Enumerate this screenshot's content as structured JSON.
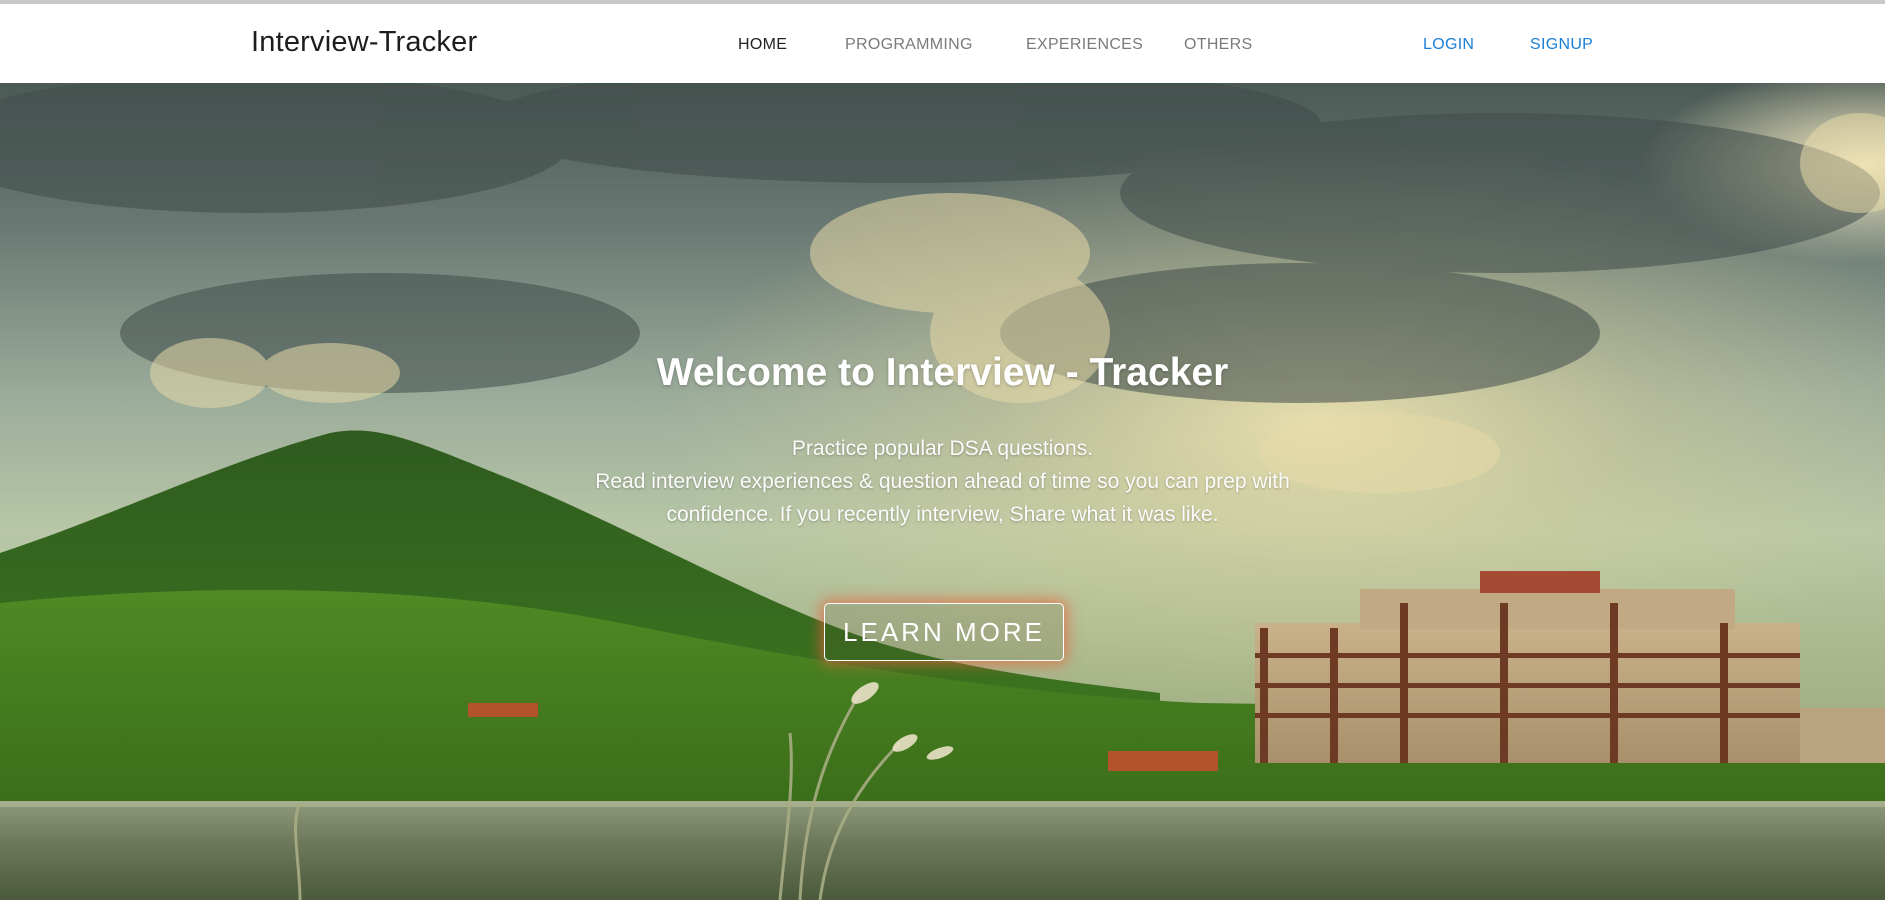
{
  "navbar": {
    "brand": "Interview-Tracker",
    "links": [
      "HOME",
      "PROGRAMMING",
      "EXPERIENCES",
      "OTHERS"
    ],
    "auth": [
      "LOGIN",
      "SIGNUP"
    ],
    "active_link": "HOME"
  },
  "hero": {
    "title": "Welcome to Interview - Tracker",
    "lines": [
      "Practice popular DSA  questions.",
      "Read interview experiences & question  ahead  of time so you can prep with",
      "confidence. If you recently interview, Share what it was like."
    ],
    "button": "LEARN MORE",
    "background_image": "landscape-hill-lake-campus-building"
  },
  "colors": {
    "link_accent": "#1a7fd6",
    "nav_text": "#7a7a7a",
    "button_glow": "#eb5f3c"
  }
}
